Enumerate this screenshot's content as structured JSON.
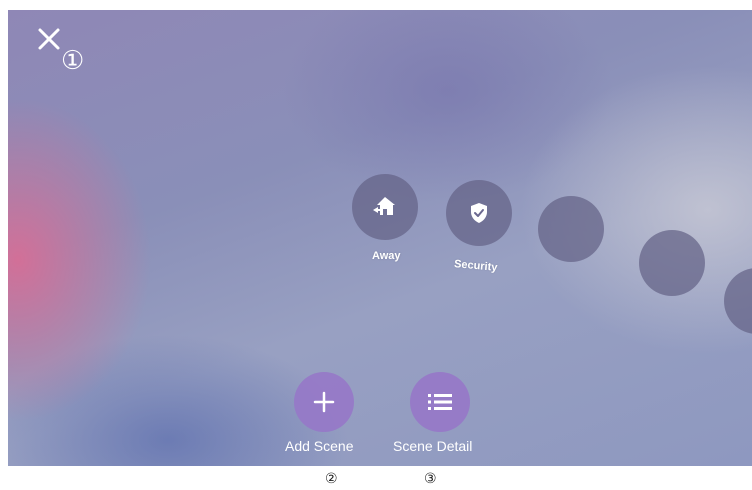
{
  "annotations": {
    "close_marker": "①",
    "add_scene_marker": "②",
    "scene_detail_marker": "③"
  },
  "scenes": [
    {
      "label": "Away",
      "icon": "home-away-icon"
    },
    {
      "label": "Security",
      "icon": "shield-check-icon"
    },
    {
      "label": "",
      "icon": ""
    },
    {
      "label": "",
      "icon": ""
    },
    {
      "label": "",
      "icon": ""
    }
  ],
  "actions": {
    "add_scene_label": "Add Scene",
    "scene_detail_label": "Scene Detail"
  },
  "colors": {
    "action_button": "#9678c8",
    "scene_circle": "#64628a"
  }
}
